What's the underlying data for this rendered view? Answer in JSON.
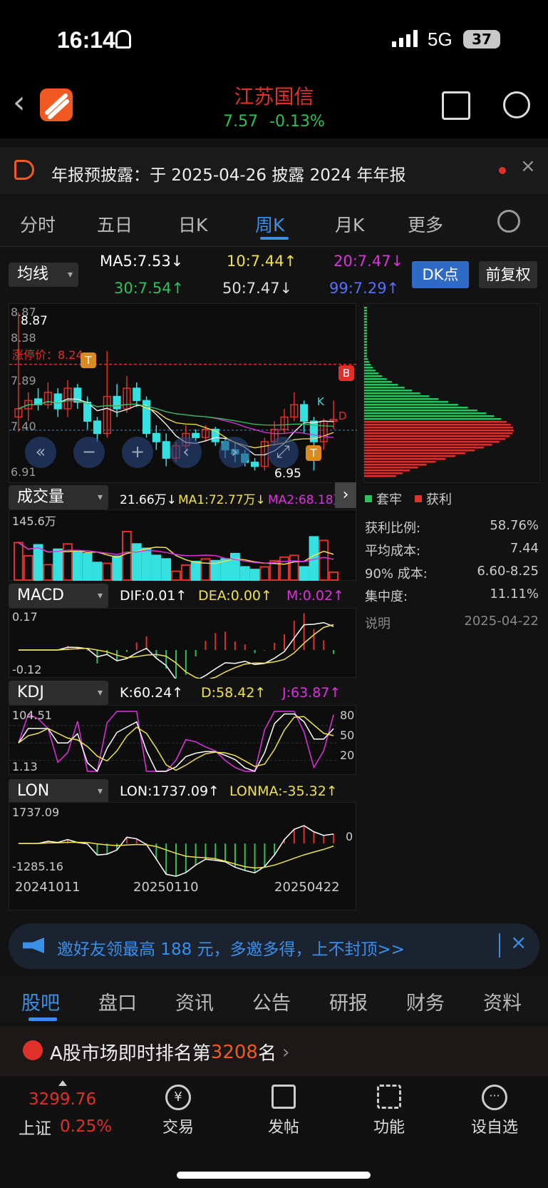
{
  "status": {
    "time": "16:14",
    "network": "5G",
    "battery": "37"
  },
  "header": {
    "name": "江苏国信",
    "price": "7.57",
    "change": "-0.13%"
  },
  "notice": {
    "text": "年报预披露：于 2025-04-26 披露 2024 年年报"
  },
  "tabs": [
    "分时",
    "五日",
    "日K",
    "周K",
    "月K",
    "更多"
  ],
  "ma": {
    "selector": "均线",
    "ma5": "MA5:7.53↓",
    "ma10": "10:7.44↑",
    "ma20": "20:7.47↓",
    "ma30": "30:7.54↑",
    "ma50": "50:7.47↓",
    "ma99": "99:7.29↑",
    "dk": "DK点",
    "fq": "前复权"
  },
  "kline": {
    "y_labels": [
      "8.87",
      "8.38",
      "7.89",
      "7.40",
      "6.91"
    ],
    "high_label": "8.87",
    "low_label": "6.95",
    "limit": "涨停价：8.24",
    "markers": {
      "t": "T",
      "b": "B",
      "k": "K",
      "d": "D"
    },
    "bars": [
      [
        7.6,
        7.7,
        7.42,
        8.87,
        1
      ],
      [
        7.7,
        7.8,
        7.55,
        7.9,
        1
      ],
      [
        7.82,
        7.75,
        7.68,
        7.95,
        0
      ],
      [
        7.75,
        7.9,
        7.7,
        8.02,
        1
      ],
      [
        7.88,
        7.7,
        7.6,
        7.95,
        0
      ],
      [
        7.7,
        7.95,
        7.6,
        8.05,
        1
      ],
      [
        7.95,
        7.78,
        7.7,
        8.0,
        0
      ],
      [
        7.78,
        7.55,
        7.45,
        7.85,
        0
      ],
      [
        7.55,
        7.4,
        7.3,
        7.6,
        0
      ],
      [
        7.4,
        7.85,
        7.35,
        8.4,
        1
      ],
      [
        7.85,
        7.7,
        7.6,
        8.0,
        0
      ],
      [
        7.7,
        7.95,
        7.65,
        8.1,
        1
      ],
      [
        7.95,
        7.8,
        7.72,
        8.02,
        0
      ],
      [
        7.8,
        7.4,
        7.35,
        7.85,
        0
      ],
      [
        7.4,
        7.3,
        7.2,
        7.5,
        0
      ],
      [
        7.3,
        7.1,
        7.0,
        7.4,
        0
      ],
      [
        7.1,
        7.25,
        7.05,
        7.3,
        1
      ],
      [
        7.25,
        7.4,
        7.2,
        7.5,
        1
      ],
      [
        7.4,
        7.35,
        7.3,
        7.45,
        0
      ],
      [
        7.35,
        7.45,
        7.3,
        7.5,
        1
      ],
      [
        7.45,
        7.3,
        7.25,
        7.48,
        0
      ],
      [
        7.3,
        7.2,
        7.1,
        7.35,
        0
      ],
      [
        7.2,
        7.15,
        7.05,
        7.3,
        0
      ],
      [
        7.15,
        7.05,
        7.0,
        7.2,
        0
      ],
      [
        7.05,
        7.0,
        6.95,
        7.1,
        0
      ],
      [
        7.0,
        7.3,
        6.95,
        7.35,
        1
      ],
      [
        7.3,
        7.45,
        7.25,
        7.55,
        1
      ],
      [
        7.45,
        7.6,
        7.4,
        7.7,
        1
      ],
      [
        7.6,
        7.75,
        7.55,
        7.9,
        1
      ],
      [
        7.75,
        7.55,
        7.4,
        7.8,
        0
      ],
      [
        7.55,
        7.3,
        6.95,
        7.6,
        0
      ],
      [
        7.3,
        7.55,
        7.2,
        7.58,
        1
      ],
      [
        7.55,
        7.57,
        7.45,
        7.8,
        1
      ]
    ]
  },
  "chip": {
    "legend_trapped": "套牢",
    "legend_profit": "获利",
    "rows": [
      {
        "k": "获利比例:",
        "v": "58.76%"
      },
      {
        "k": "平均成本:",
        "v": "7.44"
      },
      {
        "k": "90% 成本:",
        "v": "6.60-8.25"
      },
      {
        "k": "集中度:",
        "v": "11.11%"
      }
    ],
    "note": "说明",
    "date": "2025-04-22"
  },
  "volume": {
    "selector": "成交量",
    "val": "21.66万↓",
    "ma1": "MA1:72.77万↓",
    "ma2": "MA2:68.18万",
    "max": "145.6万",
    "values": [
      85,
      55,
      80,
      35,
      70,
      82,
      66,
      60,
      40,
      38,
      54,
      110,
      82,
      72,
      56,
      48,
      20,
      34,
      42,
      48,
      44,
      48,
      60,
      30,
      24,
      30,
      44,
      52,
      56,
      30,
      98,
      90,
      18
    ]
  },
  "macd": {
    "selector": "MACD",
    "dif": "DIF:0.01↑",
    "dea": "DEA:0.00↑",
    "m": "M:0.02↑",
    "top": "0.17",
    "bot": "-0.12"
  },
  "kdj": {
    "selector": "KDJ",
    "k": "K:60.24↑",
    "d": "D:58.42↑",
    "j": "J:63.87↑",
    "top": "104.51",
    "bot": "1.13",
    "l80": "80",
    "l50": "50",
    "l20": "20"
  },
  "lon": {
    "selector": "LON",
    "lon": "LON:1737.09↑",
    "lonma": "LONMA:-35.32↑",
    "top": "1737.09",
    "bot": "-1285.16",
    "zero": "0"
  },
  "dates": [
    "20241011",
    "20250110",
    "20250422"
  ],
  "promo": {
    "text": "邀好友领最高 188 元，多邀多得，上不封顶>>"
  },
  "bottom_tabs": [
    "股吧",
    "盘口",
    "资讯",
    "公告",
    "研报",
    "财务",
    "资料"
  ],
  "rank": {
    "prefix": "A股市场即时排名第",
    "num": "3208",
    "suffix": "名"
  },
  "bottom_nav": {
    "index_value": "3299.76",
    "index_name": "上证",
    "index_change": "0.25%",
    "items": [
      "交易",
      "发帖",
      "功能",
      "设自选"
    ]
  },
  "colors": {
    "up": "#e0302a",
    "down": "#35e0e0",
    "green": "#2ac25a",
    "blue": "#3a8fe8",
    "yellow": "#f2e24a",
    "magenta": "#e030e0",
    "white": "#ffffff"
  }
}
